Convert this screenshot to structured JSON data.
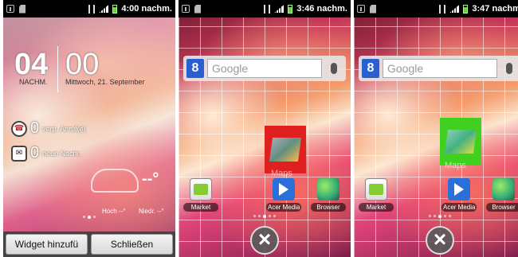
{
  "screens": [
    {
      "statusbar": {
        "time": "4:00 nachm."
      },
      "clock": {
        "hours": "04",
        "minutes": "00",
        "ampm": "NACHM.",
        "date": "Mittwoch, 21. September"
      },
      "notifications": [
        {
          "icon": "missed-call-icon",
          "count": "0",
          "label": "verp. Anruf(e)"
        },
        {
          "icon": "message-icon",
          "count": "0",
          "label": "neue Nachr."
        }
      ],
      "weather": {
        "temp": "--°",
        "high": "Hoch --°",
        "low": "Niedr. --°"
      },
      "buttons": {
        "add_widget": "Widget hinzufü",
        "close": "Schließen"
      }
    },
    {
      "statusbar": {
        "time": "3:46 nachm."
      },
      "search": {
        "placeholder": "Google",
        "logo": "8"
      },
      "maps_label": "Maps",
      "maps_highlight": "#e02020",
      "apps": [
        {
          "label": "Market"
        },
        {
          "label": "Acer Media"
        },
        {
          "label": "Browser"
        }
      ]
    },
    {
      "statusbar": {
        "time": "3:47 nachm."
      },
      "search": {
        "placeholder": "Google",
        "logo": "8"
      },
      "maps_label": "Maps",
      "maps_highlight": "#40d020",
      "apps": [
        {
          "label": "Market"
        },
        {
          "label": "Acer Media"
        },
        {
          "label": "Browser"
        }
      ]
    }
  ]
}
